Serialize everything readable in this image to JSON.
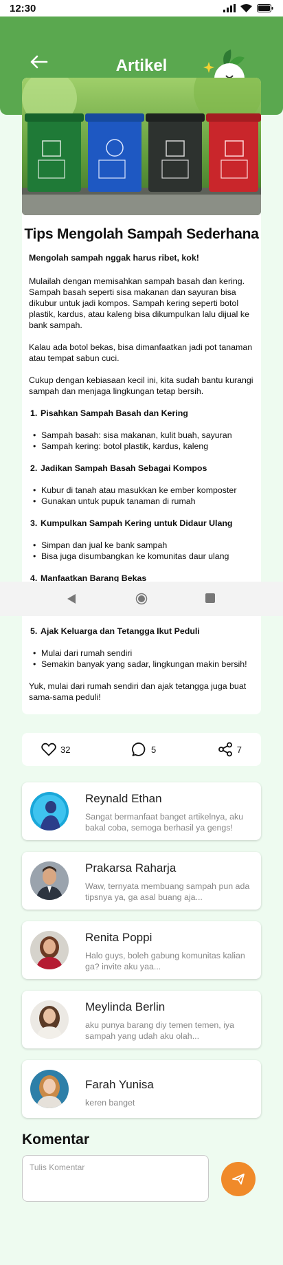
{
  "status_bar": {
    "time": "12:30"
  },
  "header": {
    "title": "Artikel"
  },
  "article": {
    "title": "Tips Mengolah Sampah Sederhana",
    "lead": "Mengolah sampah nggak harus ribet, kok!",
    "paragraphs": [
      "Mulailah dengan memisahkan sampah basah dan kering. Sampah basah seperti sisa makanan dan sayuran bisa dikubur untuk jadi kompos. Sampah kering seperti botol plastik, kardus, atau kaleng bisa dikumpulkan lalu dijual ke bank sampah.",
      "Kalau ada botol bekas, bisa dimanfaatkan jadi pot tanaman atau tempat sabun cuci.",
      "Cukup dengan kebiasaan kecil ini, kita sudah bantu kurangi sampah dan menjaga lingkungan tetap bersih."
    ],
    "sections": [
      {
        "num": "1.",
        "title": "Pisahkan Sampah Basah dan Kering",
        "bullets": [
          "Sampah basah: sisa makanan, kulit buah, sayuran",
          "Sampah kering: botol plastik, kardus, kaleng"
        ]
      },
      {
        "num": "2.",
        "title": "Jadikan Sampah Basah Sebagai Kompos",
        "bullets": [
          "Kubur di tanah atau masukkan ke ember komposter",
          "Gunakan untuk pupuk tanaman di rumah"
        ]
      },
      {
        "num": "3.",
        "title": "Kumpulkan Sampah Kering untuk Didaur Ulang",
        "bullets": [
          "Simpan dan jual ke bank sampah",
          "Bisa juga disumbangkan ke komunitas daur ulang"
        ]
      },
      {
        "num": "4.",
        "title": "Manfaatkan Barang Bekas"
      },
      {
        "num": "5.",
        "title": "Ajak Keluarga dan Tetangga Ikut Peduli",
        "bullets": [
          "Mulai dari rumah sendiri",
          "Semakin banyak yang sadar, lingkungan makin bersih!"
        ]
      }
    ],
    "closing": "Yuk, mulai dari rumah sendiri dan ajak tetangga juga buat sama-sama peduli!"
  },
  "reactions": {
    "likes": "32",
    "comments": "5",
    "shares": "7"
  },
  "comments": [
    {
      "name": "Reynald Ethan",
      "text": "Sangat bermanfaat banget artikelnya, aku bakal coba, semoga berhasil ya gengs!"
    },
    {
      "name": "Prakarsa Raharja",
      "text": "Waw, ternyata membuang sampah pun ada tipsnya ya, ga asal buang aja..."
    },
    {
      "name": "Renita Poppi",
      "text": "Halo guys, boleh gabung komunitas kalian ga? invite aku yaa..."
    },
    {
      "name": "Meylinda Berlin",
      "text": "aku punya barang diy temen temen, iya sampah yang udah aku olah..."
    },
    {
      "name": "Farah Yunisa",
      "text": "keren banget"
    }
  ],
  "comment_form": {
    "heading": "Komentar",
    "placeholder": "Tulis Komentar"
  },
  "colors": {
    "header_green": "#5aa84f",
    "background": "#eefbf0",
    "send_orange": "#f08a2a"
  }
}
